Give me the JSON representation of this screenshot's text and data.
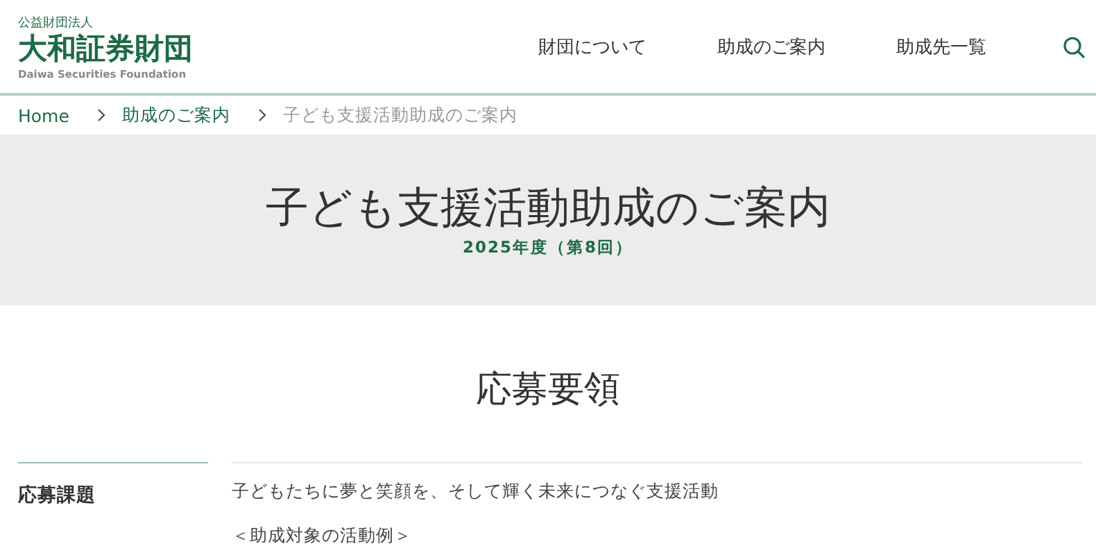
{
  "header": {
    "logo": {
      "kicker": "公益財団法人",
      "name": "大和証券財団",
      "english": "Daiwa Securities Foundation"
    },
    "nav": [
      {
        "label": "財団について"
      },
      {
        "label": "助成のご案内"
      },
      {
        "label": "助成先一覧"
      }
    ]
  },
  "breadcrumb": [
    {
      "label": "Home",
      "current": false
    },
    {
      "label": "助成のご案内",
      "current": false
    },
    {
      "label": "子ども支援活動助成のご案内",
      "current": true
    }
  ],
  "hero": {
    "title": "子ども支援活動助成のご案内",
    "subtitle": "2025年度（第8回）"
  },
  "section": {
    "heading": "応募要領",
    "rows": [
      {
        "label": "応募課題",
        "paragraphs": [
          "子どもたちに夢と笑顔を、そして輝く未来につなぐ支援活動",
          "＜助成対象の活動例＞"
        ]
      }
    ]
  }
}
